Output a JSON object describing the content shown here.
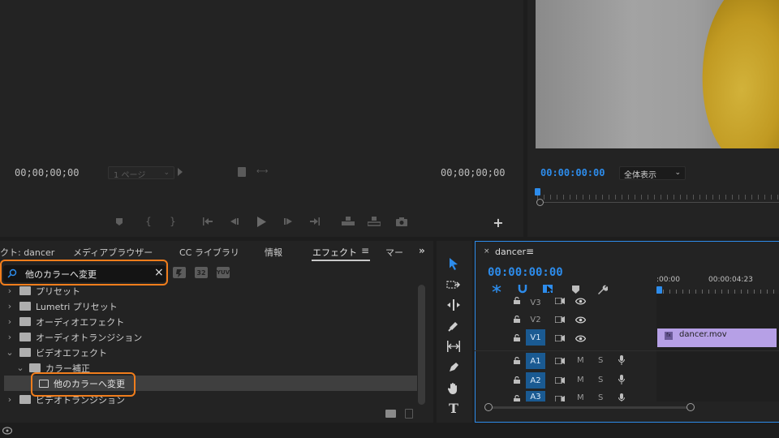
{
  "colors": {
    "accent_blue": "#2d8ceb",
    "highlight_orange": "#f07d1c",
    "clip_purple": "#b6a0e6",
    "playhead_red": "#c8372d"
  },
  "source_monitor": {
    "timecode_left": "00;00;00;00",
    "timecode_right": "00;00;00;00",
    "page_select": "1 ページ",
    "transport_icons": [
      "marker-icon",
      "mark-in-icon",
      "mark-out-icon",
      "go-to-in-icon",
      "step-back-icon",
      "play-icon",
      "step-forward-icon",
      "go-to-out-icon",
      "insert-icon",
      "overwrite-icon",
      "export-frame-icon",
      "add-button-icon"
    ]
  },
  "program_monitor": {
    "timecode": "00:00:00:00",
    "fit_select": "全体表示"
  },
  "project_panel": {
    "tabs": [
      "クト: dancer",
      "メディアブラウザー",
      "CC ライブラリ",
      "情報",
      "エフェクト",
      "マー"
    ],
    "active_tab": "エフェクト",
    "search_value": "他のカラーへ変更",
    "badge_labels": [
      "32",
      "YUV"
    ],
    "tree": [
      {
        "label": "プリセット"
      },
      {
        "label": "Lumetri プリセット"
      },
      {
        "label": "オーディオエフェクト"
      },
      {
        "label": "オーディオトランジション"
      },
      {
        "label": "ビデオエフェクト"
      },
      {
        "label": "カラー補正"
      },
      {
        "label": "他のカラーへ変更"
      },
      {
        "label": "ビデオトランジション"
      }
    ]
  },
  "timeline": {
    "sequence_name": "dancer",
    "timecode": "00:00:00:00",
    "ruler_labels": [
      ":00:00",
      "00:00:04:23"
    ],
    "video_tracks": [
      "V3",
      "V2",
      "V1"
    ],
    "audio_tracks": [
      "A1",
      "A2",
      "A3"
    ],
    "mute_label": "M",
    "solo_label": "S",
    "clip_name": "dancer.mov",
    "clip_badge": "fx"
  },
  "tools": [
    "selection-tool-icon",
    "track-select-tool-icon",
    "ripple-edit-tool-icon",
    "razor-tool-icon",
    "slip-tool-icon",
    "pen-tool-icon",
    "hand-tool-icon",
    "type-tool-icon"
  ]
}
